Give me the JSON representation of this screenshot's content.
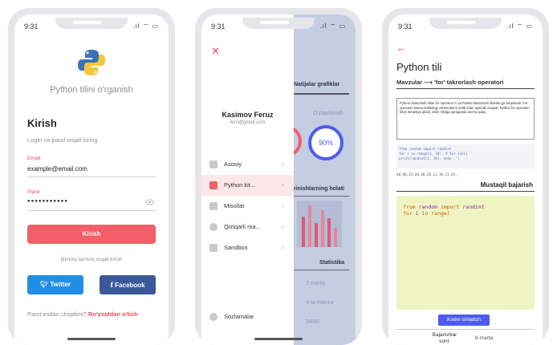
{
  "status": {
    "time": "9:31",
    "signal": ".ıl ⌔ ▭"
  },
  "login": {
    "app_title": "Python tilini o'rganish",
    "heading": "Kirish",
    "subheading": "Login va parol orqali kiring",
    "email_label": "Email",
    "email_value": "example@email.com",
    "password_label": "Parol",
    "password_value": "●●●●●●●●●●●",
    "submit_label": "Kirish",
    "social_label": "Ijtimoiy tarmoq orqali kirish",
    "twitter_label": "Twitter",
    "facebook_label": "Facebook",
    "forgot_text": "Parol esdan chiqdimi?",
    "register_link": "Ro'yxatdan o'tish"
  },
  "drawer": {
    "user_name": "Kasimov Feruz",
    "user_email": "fern@gmail.com",
    "items": [
      {
        "label": "Asosiy"
      },
      {
        "label": "Python kit..."
      },
      {
        "label": "Misollar"
      },
      {
        "label": "Qiziqarli ma..."
      },
      {
        "label": "Sandbox"
      }
    ],
    "settings_label": "Sozlamalar",
    "bg": {
      "results_title": "Natijalar grafiklar",
      "mastered": "O'zlashtirish",
      "percent": "90%",
      "status_title": "rinishlarning holati",
      "stats_title": "Statistika",
      "row1": "3 marta",
      "row2": "4 ta mavzu",
      "row3": "24/82"
    }
  },
  "lesson": {
    "title": "Python tili",
    "breadcrumb": "Mavzular ⟶ 'for' takrorlash operatori",
    "description": "Python dasturlash tilida for operatori C va Paskal dasturlash tillarida ga farqlanadi. For operatori ketma-ketlikdagi elementlarni tartib bilan aylantib chiqadi. Python for operatori bilan iteratsiya qiladi, while sikliga qaraganda ancha qulay.",
    "code_line1": "from random import randint",
    "code_line2": "for i in range(1, 10):   # for sikli",
    "code_line3": "    print(randint(1, 10), end=',')",
    "output": "40,90,35,28,40,20,12,10,11,65,",
    "exercise_title": "Mustaqil bajarish",
    "editor_kw1": "from",
    "editor_mod": "random",
    "editor_kw2": "import",
    "editor_fn": "randint",
    "editor_line2_kw": "for",
    "editor_line2_var": "i",
    "editor_line2_in": "in",
    "editor_line2_fn": "range(",
    "run_label": "Kodni ishlatish",
    "attempts_label": "Bajarishlar soni:",
    "attempts_value": "6 marta"
  },
  "colors": {
    "accent": "#f25f69",
    "twitter": "#1f8fe5",
    "facebook": "#3b5998",
    "run": "#4d5bf0"
  }
}
